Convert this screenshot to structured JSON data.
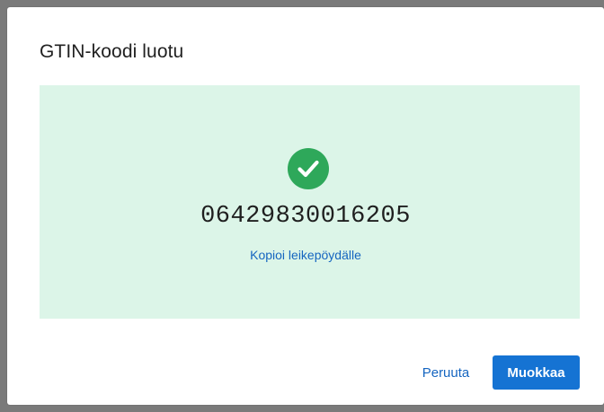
{
  "dialog": {
    "title": "GTIN-koodi luotu",
    "code": "06429830016205",
    "copy_link": "Kopioi leikepöydälle",
    "success_icon": "check-circle-icon",
    "cancel_label": "Peruuta",
    "edit_label": "Muokkaa"
  },
  "colors": {
    "panel_bg": "#dcf5e8",
    "success": "#2ea85a",
    "primary": "#1573d3",
    "link": "#1565c0"
  }
}
